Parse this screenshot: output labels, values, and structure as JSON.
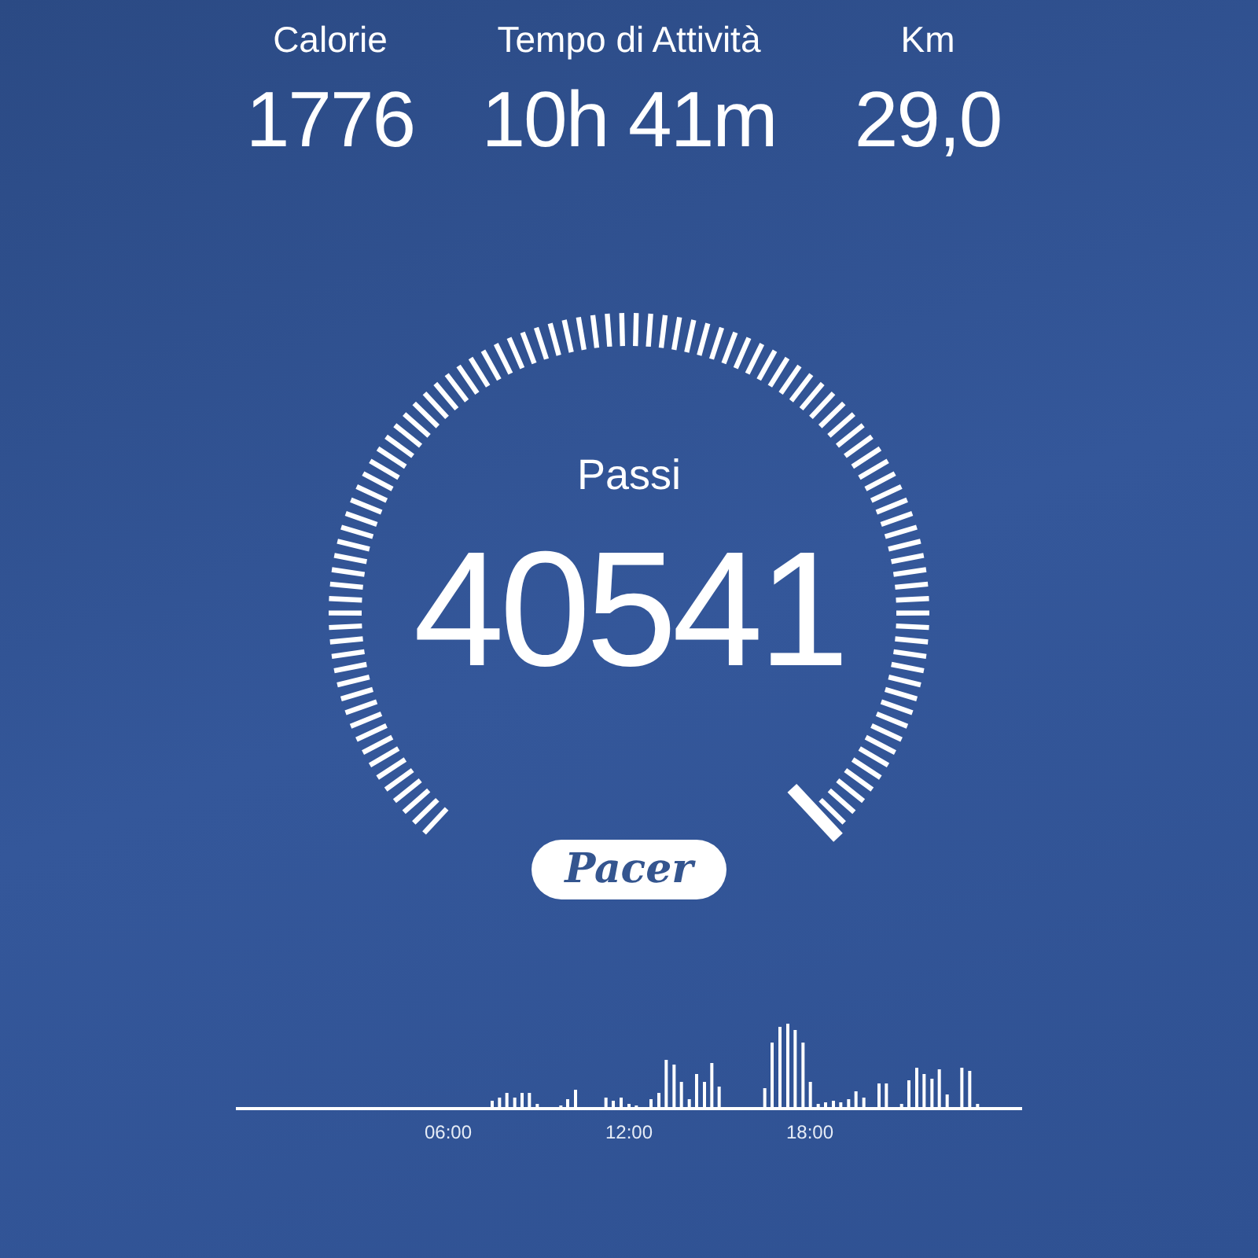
{
  "stats": [
    {
      "label": "Calorie",
      "value": "1776"
    },
    {
      "label": "Tempo di Attività",
      "value": "10h 41m"
    },
    {
      "label": "Km",
      "value": "29,0"
    }
  ],
  "steps": {
    "label": "Passi",
    "value": "40541"
  },
  "logo": {
    "text": "Pacer"
  },
  "activity_chart": {
    "time_labels": [
      "06:00",
      "12:00",
      "18:00"
    ]
  }
}
